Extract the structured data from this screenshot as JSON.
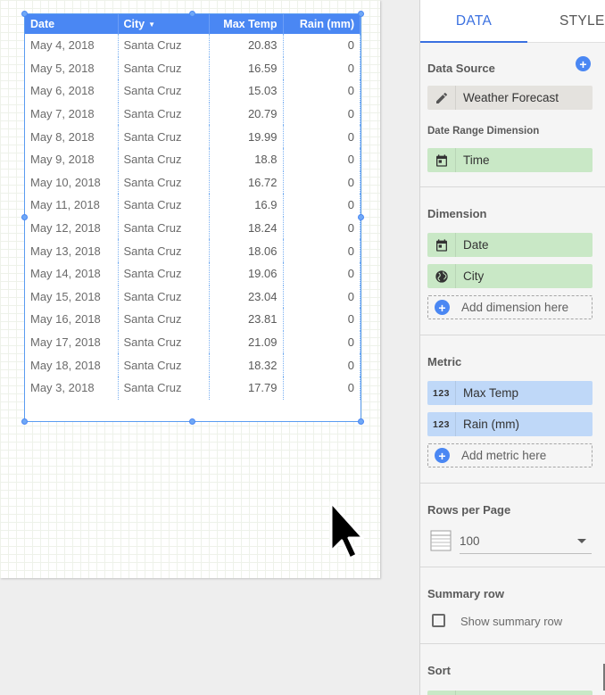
{
  "table": {
    "headers": [
      "Date",
      "City",
      "Max Temp",
      "Rain (mm)"
    ],
    "rows": [
      [
        "May 4, 2018",
        "Santa Cruz",
        "20.83",
        "0"
      ],
      [
        "May 5, 2018",
        "Santa Cruz",
        "16.59",
        "0"
      ],
      [
        "May 6, 2018",
        "Santa Cruz",
        "15.03",
        "0"
      ],
      [
        "May 7, 2018",
        "Santa Cruz",
        "20.79",
        "0"
      ],
      [
        "May 8, 2018",
        "Santa Cruz",
        "19.99",
        "0"
      ],
      [
        "May 9, 2018",
        "Santa Cruz",
        "18.8",
        "0"
      ],
      [
        "May 10, 2018",
        "Santa Cruz",
        "16.72",
        "0"
      ],
      [
        "May 11, 2018",
        "Santa Cruz",
        "16.9",
        "0"
      ],
      [
        "May 12, 2018",
        "Santa Cruz",
        "18.24",
        "0"
      ],
      [
        "May 13, 2018",
        "Santa Cruz",
        "18.06",
        "0"
      ],
      [
        "May 14, 2018",
        "Santa Cruz",
        "19.06",
        "0"
      ],
      [
        "May 15, 2018",
        "Santa Cruz",
        "23.04",
        "0"
      ],
      [
        "May 16, 2018",
        "Santa Cruz",
        "23.81",
        "0"
      ],
      [
        "May 17, 2018",
        "Santa Cruz",
        "21.09",
        "0"
      ],
      [
        "May 18, 2018",
        "Santa Cruz",
        "18.32",
        "0"
      ],
      [
        "May 3, 2018",
        "Santa Cruz",
        "17.79",
        "0"
      ]
    ],
    "sorted_column": "City"
  },
  "panel": {
    "tabs": {
      "data": "DATA",
      "style": "STYLE"
    },
    "data_source": {
      "title": "Data Source",
      "value": "Weather Forecast",
      "icon": "pencil-icon"
    },
    "date_range": {
      "title": "Date Range Dimension",
      "value": "Time",
      "icon": "calendar-icon"
    },
    "dimension": {
      "title": "Dimension",
      "items": [
        {
          "label": "Date",
          "icon": "calendar-icon"
        },
        {
          "label": "City",
          "icon": "globe-icon"
        }
      ],
      "add_label": "Add dimension here"
    },
    "metric": {
      "title": "Metric",
      "icon_text": "123",
      "items": [
        {
          "label": "Max Temp"
        },
        {
          "label": "Rain (mm)"
        }
      ],
      "add_label": "Add metric here"
    },
    "rows_per_page": {
      "title": "Rows per Page",
      "value": "100"
    },
    "summary_row": {
      "title": "Summary row",
      "checkbox_label": "Show summary row",
      "checked": false
    },
    "sort": {
      "title": "Sort"
    }
  },
  "colors": {
    "accent": "#4a87f3",
    "dimension_chip": "#c9e8c6",
    "metric_chip": "#bfd8f8",
    "source_chip": "#e4e2de"
  }
}
